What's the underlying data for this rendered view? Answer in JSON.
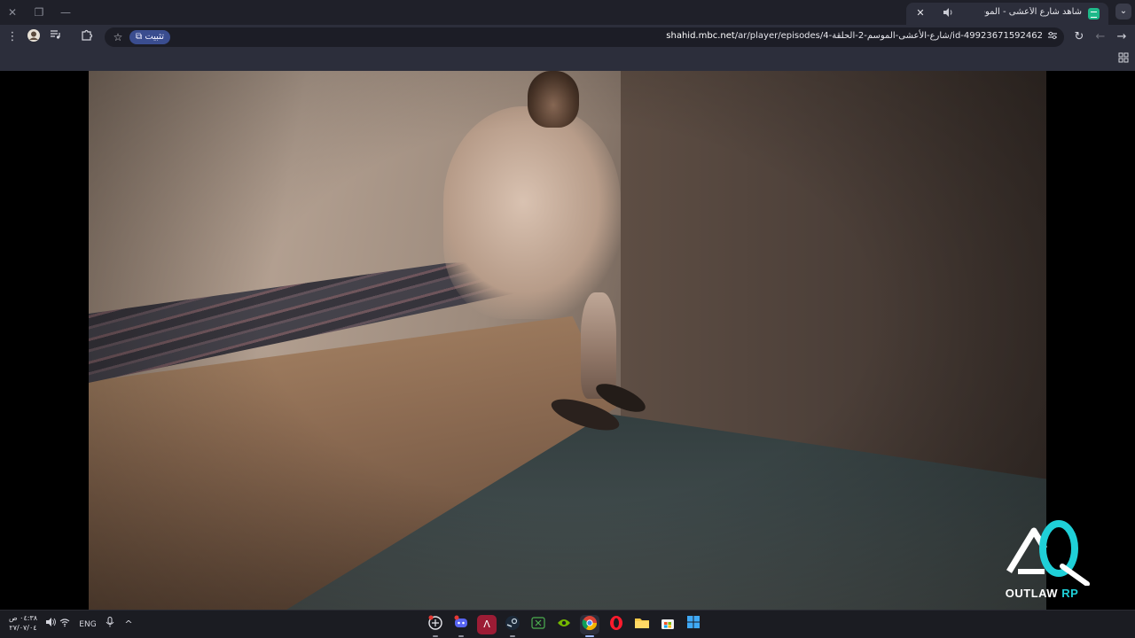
{
  "browser": {
    "tab": {
      "title": "شاهد شارع الأعشى - الموسم",
      "audio_icon": "speaker-icon",
      "close_label": "✕"
    },
    "new_tab_label": "+",
    "tab_search_label": "⌄",
    "window_controls": {
      "close": "✕",
      "restore": "❐",
      "minimize": "—"
    },
    "address_bar": {
      "host": "shahid.mbc.net",
      "path": "/ar/player/episodes/4-شارع-الأعشى-الموسم-2-الحلقة/id-49923671592462",
      "install_chip_label": "تثبيت"
    }
  },
  "video": {
    "watermark": {
      "brand": "OUTLAW",
      "suffix": " RP"
    }
  },
  "taskbar": {
    "clock": {
      "time": "٠٤:٣٨ ص",
      "date": "٢٧/٠٧/٠٤"
    },
    "language": "ENG",
    "apps": [
      "chatgpt-icon",
      "discord-icon",
      "autodesk-icon",
      "steam-icon",
      "xbox-icon",
      "nvidia-icon",
      "chrome-icon",
      "opera-icon",
      "file-explorer-icon",
      "microsoft-store-icon",
      "windows-start-icon"
    ]
  },
  "colors": {
    "chrome_dark": "#1f2029",
    "chrome_toolbar": "#2c2e3b",
    "omnibox": "#1c1d26",
    "install_chip": "#3a4d8f",
    "watermark_accent": "#1fd0d8",
    "taskbar": "#1b1c22"
  }
}
